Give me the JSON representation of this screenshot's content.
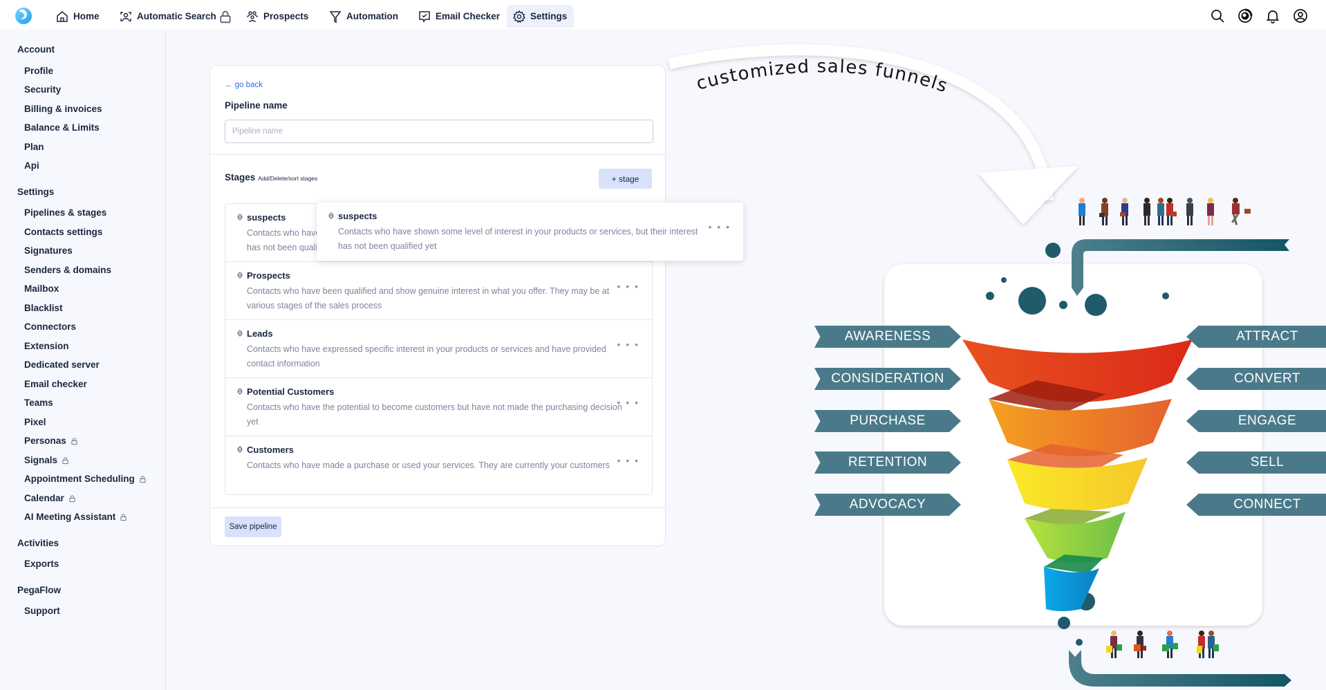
{
  "header": {
    "nav": [
      {
        "label": "Home",
        "icon": "home-icon"
      },
      {
        "label": "Automatic Search",
        "icon": "face-scan-icon",
        "locked": true
      },
      {
        "label": "Prospects",
        "icon": "users-icon"
      },
      {
        "label": "Automation",
        "icon": "funnel-icon"
      },
      {
        "label": "Email Checker",
        "icon": "check-message-icon"
      },
      {
        "label": "Settings",
        "icon": "gear-icon",
        "active": true
      }
    ],
    "right_icons": [
      "search-icon",
      "chrome-extension-icon",
      "bell-icon",
      "user-circle-icon"
    ]
  },
  "sidebar": {
    "sections": [
      {
        "title": "Account",
        "items": [
          {
            "label": "Profile"
          },
          {
            "label": "Security"
          },
          {
            "label": "Billing & invoices"
          },
          {
            "label": "Balance & Limits"
          },
          {
            "label": "Plan"
          },
          {
            "label": "Api"
          }
        ]
      },
      {
        "title": "Settings",
        "items": [
          {
            "label": "Pipelines & stages"
          },
          {
            "label": "Contacts settings"
          },
          {
            "label": "Signatures"
          },
          {
            "label": "Senders & domains"
          },
          {
            "label": "Mailbox"
          },
          {
            "label": "Blacklist"
          },
          {
            "label": "Connectors"
          },
          {
            "label": "Extension"
          },
          {
            "label": "Dedicated server"
          },
          {
            "label": "Email checker"
          },
          {
            "label": "Teams"
          },
          {
            "label": "Pixel"
          },
          {
            "label": "Personas",
            "locked": true
          },
          {
            "label": "Signals",
            "locked": true
          },
          {
            "label": "Appointment Scheduling",
            "locked": true
          },
          {
            "label": "Calendar",
            "locked": true
          },
          {
            "label": "AI Meeting Assistant",
            "locked": true
          }
        ]
      },
      {
        "title": "Activities",
        "items": [
          {
            "label": "Exports"
          }
        ]
      },
      {
        "title": "PegaFlow",
        "items": [
          {
            "label": "Support"
          }
        ]
      }
    ]
  },
  "editor": {
    "go_back": "← go back",
    "pipeline_label": "Pipeline name",
    "pipeline_value": "",
    "pipeline_placeholder": "Pipeline name",
    "stages_title": "Stages",
    "stages_subtitle": "Add/Delete/sort stages",
    "add_stage": "+ stage",
    "more_label": "• • •",
    "stages": [
      {
        "name": "suspects",
        "description": "Contacts who have shown some level of interest in your products or services, but their interest has not been qualified yet"
      },
      {
        "name": "Prospects",
        "description": "Contacts who have been qualified and show genuine interest in what you offer. They may be at various stages of the sales process"
      },
      {
        "name": "Leads",
        "description": "Contacts who have expressed specific interest in your products or services and have provided contact information"
      },
      {
        "name": "Potential Customers",
        "description": "Contacts who have the potential to become customers but have not made the purchasing decision yet"
      },
      {
        "name": "Customers",
        "description": "Contacts who have made a purchase or used your services. They are currently your customers"
      }
    ],
    "dragging": {
      "name": "suspects",
      "description": "Contacts who have shown some level of interest in your products or services, but their interest has not been qualified yet"
    },
    "save_label": "Save pipeline"
  },
  "illustration": {
    "caption": "customized sales funnels",
    "left_labels": [
      "AWARENESS",
      "CONSIDERATION",
      "PURCHASE",
      "RETENTION",
      "ADVOCACY"
    ],
    "right_labels": [
      "ATTRACT",
      "CONVERT",
      "ENGAGE",
      "SELL",
      "CONNECT"
    ],
    "funnel_colors": [
      "#e2391c",
      "#f08a24",
      "#f7d42a",
      "#8fd13f",
      "#0f9be0"
    ],
    "ribbon_color": "#4a7a8a"
  }
}
